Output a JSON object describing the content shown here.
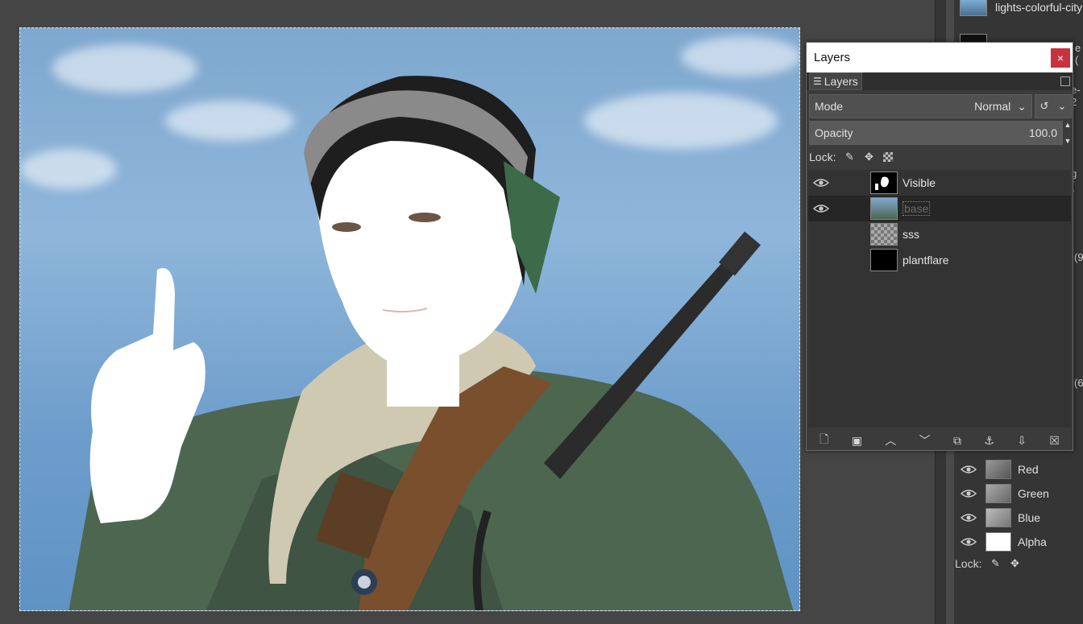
{
  "canvas": {
    "image_description_alt": ""
  },
  "right_dock": {
    "images": [
      {
        "name": "lights-colorful-city"
      }
    ],
    "cut_texts": [
      "e (",
      "e-2",
      "g (",
      "(9",
      "(6"
    ],
    "channels": [
      {
        "name": "Red",
        "visible": true
      },
      {
        "name": "Green",
        "visible": true
      },
      {
        "name": "Blue",
        "visible": true
      },
      {
        "name": "Alpha",
        "visible": true
      }
    ],
    "lock_label": "Lock:"
  },
  "layers_window": {
    "title": "Layers",
    "close_glyph": "×",
    "tab_label": "Layers",
    "mode_label": "Mode",
    "mode_value": "Normal",
    "opacity_label": "Opacity",
    "opacity_value": "100.0",
    "lock_label": "Lock:",
    "layers": [
      {
        "name": "Visible",
        "visible": true,
        "selected": false
      },
      {
        "name": "base",
        "visible": true,
        "selected": true
      },
      {
        "name": "sss",
        "visible": false,
        "selected": false
      },
      {
        "name": "plantflare",
        "visible": false,
        "selected": false
      }
    ],
    "toolbar_icons": [
      "new-layer-icon",
      "new-layer-group-icon",
      "raise-layer-icon",
      "lower-layer-icon",
      "duplicate-layer-icon",
      "anchor-layer-icon",
      "merge-layer-icon",
      "delete-layer-icon"
    ]
  },
  "colors": {
    "close_button": "#c8313d",
    "panel_bg": "#3b3b3b",
    "selected_row": "#262626"
  }
}
